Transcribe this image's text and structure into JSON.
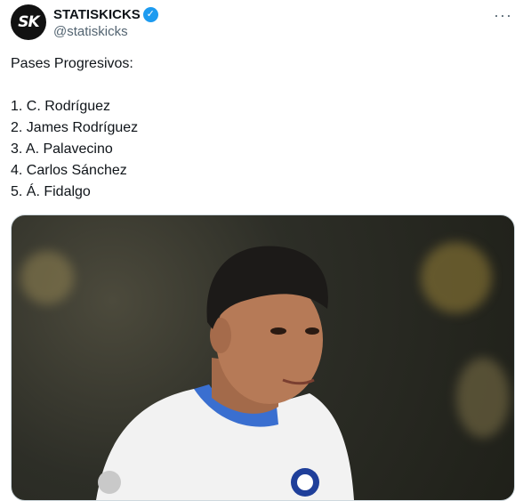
{
  "account": {
    "avatar_text": "SK",
    "display_name": "STATISKICKS",
    "verified_icon": "verified-badge-icon",
    "handle": "@statiskicks",
    "more_label": "···"
  },
  "tweet": {
    "lines": [
      "Pases Progresivos:",
      "",
      "1. C. Rodríguez",
      "2. James Rodríguez",
      "3. A. Palavecino",
      "4. Carlos Sánchez",
      "5. Á. Fidalgo"
    ]
  },
  "media": {
    "description_icon": "photo-player-icon",
    "colors": {
      "shirt": "#f2f2f2",
      "collar": "#3a6fd0",
      "background": "#2d2e27"
    }
  }
}
